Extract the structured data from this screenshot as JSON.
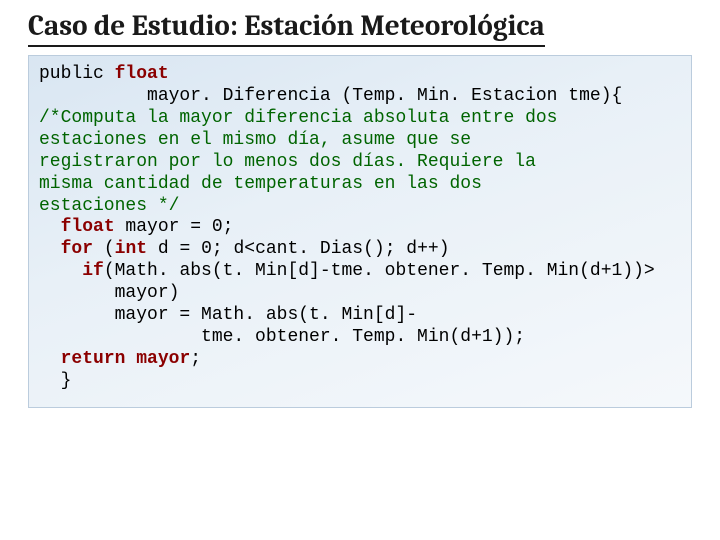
{
  "title": "Caso de Estudio: Estación Meteorológica",
  "code": {
    "l1_a": "public ",
    "l1_kw": "float",
    "l2": "          mayor. Diferencia (Temp. Min. Estacion tme){",
    "l3": "/*Computa la mayor diferencia absoluta entre dos",
    "l4": "estaciones en el mismo día, asume que se",
    "l5": "registraron por lo menos dos días. Requiere la",
    "l6": "misma cantidad de temperaturas en las dos",
    "l7": "estaciones */",
    "l8_a": "  ",
    "l8_kw": "float ",
    "l8_b": "mayor = 0;",
    "l9_a": "  ",
    "l9_kw1": "for ",
    "l9_b": "(",
    "l9_kw2": "int ",
    "l9_c": "d = 0; d<cant. Dias(); d++)",
    "l10_a": "    ",
    "l10_kw": "if",
    "l10_b": "(Math. abs(t. Min[d]-tme. obtener. Temp. Min(d+1))>",
    "l11": "       mayor)",
    "l12": "       mayor = Math. abs(t. Min[d]-",
    "l13": "               tme. obtener. Temp. Min(d+1));",
    "l14_a": "  ",
    "l14_kw": "return ",
    "l14_var": "mayor",
    "l14_b": ";",
    "l15": "  }"
  }
}
